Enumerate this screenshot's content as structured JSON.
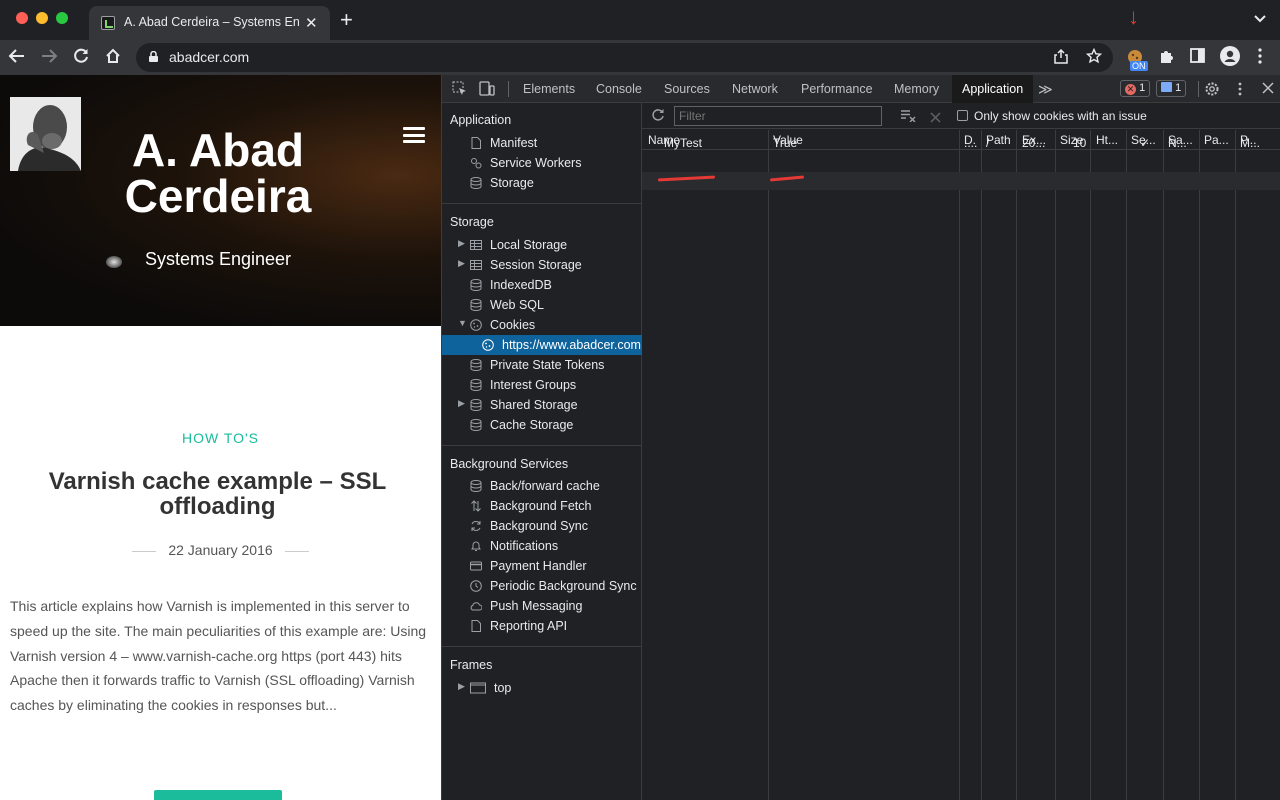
{
  "browser": {
    "tab_title": "A. Abad Cerdeira – Systems En",
    "tab_close": "✕",
    "new_tab": "+",
    "tab_menu": "⌄",
    "url": "abadcer.com",
    "ext_badge": "ON",
    "colors": {
      "close": "#ff5f57",
      "minimize": "#febc2e",
      "maximize": "#28c840"
    }
  },
  "page": {
    "site_title": "A. Abad Cerdeira",
    "site_subtitle": "Systems Engineer",
    "category": "HOW TO'S",
    "post_title": "Varnish cache example – SSL offloading",
    "post_date": "22 January 2016",
    "excerpt": "This article explains how Varnish is implemented in this server to speed up the site. The main peculiarities of this example are: Using Varnish version 4 – www.varnish-cache.org https (port 443) hits Apache then it forwards traffic to Varnish (SSL offloading) Varnish caches by eliminating the cookies in responses but..."
  },
  "devtools": {
    "tabs": [
      "Elements",
      "Console",
      "Sources",
      "Network",
      "Performance",
      "Memory",
      "Application"
    ],
    "active_tab": "Application",
    "more_tabs": "≫",
    "errors": "1",
    "messages": "1",
    "sidebar": {
      "application_header": "Application",
      "application_items": [
        "Manifest",
        "Service Workers",
        "Storage"
      ],
      "storage_header": "Storage",
      "storage_items": [
        "Local Storage",
        "Session Storage",
        "IndexedDB",
        "Web SQL",
        "Cookies",
        "https://www.abadcer.com",
        "Private State Tokens",
        "Interest Groups",
        "Shared Storage",
        "Cache Storage"
      ],
      "background_header": "Background Services",
      "background_items": [
        "Back/forward cache",
        "Background Fetch",
        "Background Sync",
        "Notifications",
        "Payment Handler",
        "Periodic Background Sync",
        "Push Messaging",
        "Reporting API"
      ],
      "frames_header": "Frames",
      "frames_items": [
        "top"
      ]
    },
    "cookies": {
      "filter_placeholder": "Filter",
      "only_issues_label": "Only show cookies with an issue",
      "columns": [
        "Name",
        "Value",
        "D.",
        "Path",
        "Ex...",
        "Size",
        "Ht...",
        "Se...",
        "Sa...",
        "Pa...",
        "P..."
      ],
      "rows": [
        {
          "name": "MyTest",
          "value": "True",
          "domain": "....",
          "path": "/",
          "expires": "20...",
          "size": "10",
          "httponly": "",
          "secure": "✓",
          "samesite": "N...",
          "partition": "",
          "priority": "M..."
        }
      ]
    }
  }
}
